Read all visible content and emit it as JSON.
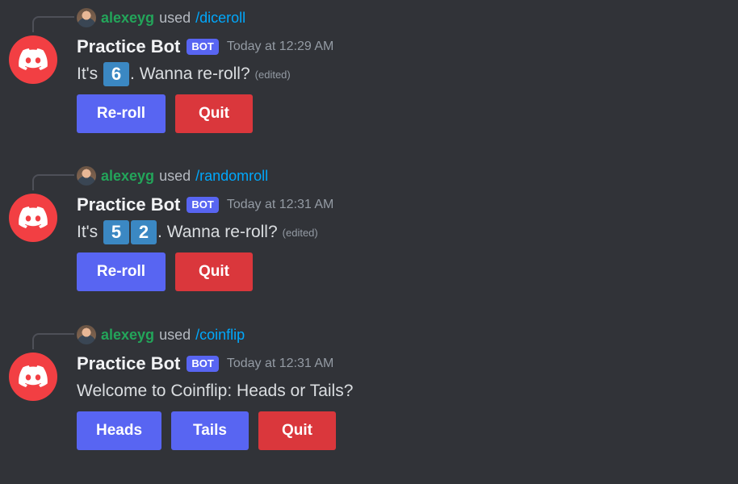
{
  "colors": {
    "background": "#313338",
    "blurple": "#5865f2",
    "danger": "#da373c",
    "mention_green": "#23a55a",
    "command_blue": "#00a8fc",
    "dice_blue": "#3b88c3"
  },
  "messages": [
    {
      "reply": {
        "user": "alexeyg",
        "used": "used",
        "command": "/diceroll"
      },
      "bot": {
        "name": "Practice Bot",
        "tag": "BOT",
        "time": "Today at 12:29 AM"
      },
      "content": {
        "prefix": "It's",
        "dice": [
          "6"
        ],
        "suffix": ". Wanna re-roll?",
        "edited": "(edited)"
      },
      "buttons": [
        "Re-roll",
        "Quit"
      ]
    },
    {
      "reply": {
        "user": "alexeyg",
        "used": "used",
        "command": "/randomroll"
      },
      "bot": {
        "name": "Practice Bot",
        "tag": "BOT",
        "time": "Today at 12:31 AM"
      },
      "content": {
        "prefix": "It's",
        "dice": [
          "5",
          "2"
        ],
        "suffix": ". Wanna re-roll?",
        "edited": "(edited)"
      },
      "buttons": [
        "Re-roll",
        "Quit"
      ]
    },
    {
      "reply": {
        "user": "alexeyg",
        "used": "used",
        "command": "/coinflip"
      },
      "bot": {
        "name": "Practice Bot",
        "tag": "BOT",
        "time": "Today at 12:31 AM"
      },
      "content": {
        "text": "Welcome to Coinflip: Heads or Tails?"
      },
      "buttons": [
        "Heads",
        "Tails",
        "Quit"
      ]
    }
  ],
  "icons": {
    "bot_avatar": "discord-logo-icon",
    "reply_avatar": "user-avatar-icon"
  }
}
